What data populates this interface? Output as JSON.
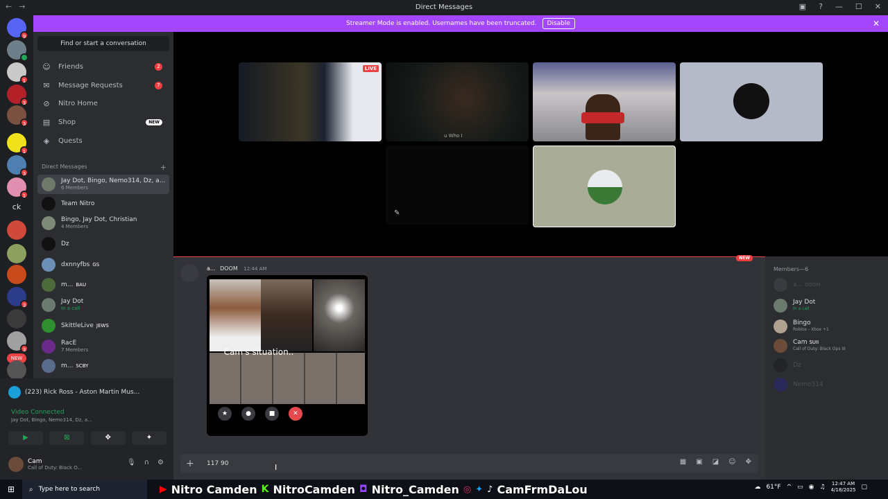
{
  "window": {
    "title": "Direct Messages",
    "nav_back": "←",
    "nav_fwd": "→"
  },
  "banner": {
    "text": "Streamer Mode is enabled. Usernames have been truncated.",
    "button": "Disable"
  },
  "servers": {
    "badges": [
      "9",
      "1",
      "3",
      "3",
      "1",
      "3",
      "1",
      "3",
      "3"
    ],
    "ck": "ck",
    "new": "NEW"
  },
  "sidebar": {
    "search_label": "Find or start a conversation",
    "items": [
      {
        "label": "Friends",
        "icon": "friends-icon",
        "count": "2"
      },
      {
        "label": "Message Requests",
        "icon": "mail-icon",
        "count": "7"
      },
      {
        "label": "Nitro Home",
        "icon": "nitro-icon"
      },
      {
        "label": "Shop",
        "icon": "shop-icon",
        "badge": "NEW"
      },
      {
        "label": "Quests",
        "icon": "quests-icon"
      }
    ],
    "dm_header": "Direct Messages",
    "dms": [
      {
        "name": "Jay Dot, Bingo, Nemo314, Dz, a...",
        "sub": "6 Members"
      },
      {
        "name": "Team Nitro",
        "sub": ""
      },
      {
        "name": "Bingo, Jay Dot, Christian",
        "sub": "4 Members"
      },
      {
        "name": "Dz",
        "sub": ""
      },
      {
        "name": "dxnnyfbs",
        "sub": "",
        "tag": "GS"
      },
      {
        "name": "m...",
        "sub": "",
        "tag": "BAU"
      },
      {
        "name": "Jay Dot",
        "sub": "In a call"
      },
      {
        "name": "SkittleLive",
        "sub": "",
        "tag": "JEWS"
      },
      {
        "name": "RacE",
        "sub": "7 Members"
      },
      {
        "name": "m...",
        "sub": "",
        "tag": "SCBY"
      }
    ]
  },
  "voice": {
    "now_playing": "(223) Rick Ross - Aston Martin Mus...",
    "status": "Video Connected",
    "participants": "Jay Dot, Bingo, Nemo314, Dz, a..."
  },
  "user": {
    "name": "Cam",
    "status": "Call of Duty: Black O..."
  },
  "stage": {
    "live_label": "LIVE",
    "tile1_caption": "u Who I"
  },
  "chat": {
    "new_label": "NEW",
    "author": "a...",
    "tag": "DOOM",
    "time": "12:44 AM",
    "caption": "Cam's situation..",
    "composer_value": "117 90"
  },
  "members": {
    "header": "Members—6",
    "list": [
      {
        "name": "a...",
        "sub": "",
        "tag": "DOOM",
        "dim": true
      },
      {
        "name": "Jay Dot",
        "sub": "In a call",
        "dim": false
      },
      {
        "name": "Bingo",
        "sub": "Roblox - Xbox +1",
        "dim": false
      },
      {
        "name": "Cam",
        "sub": "Call of Duty: Black Ops III",
        "tag": "SUII",
        "dim": false
      },
      {
        "name": "Dz",
        "sub": "",
        "dim": true
      },
      {
        "name": "Nemo314",
        "sub": "",
        "dim": true
      }
    ]
  },
  "taskbar": {
    "search_placeholder": "Type here to search",
    "overlay": [
      "Nitro Camden",
      "NitroCamden",
      "Nitro_Camden",
      "CamFrmDaLou"
    ],
    "weather": "61°F",
    "time": "12:47 AM",
    "date": "4/18/2025"
  }
}
